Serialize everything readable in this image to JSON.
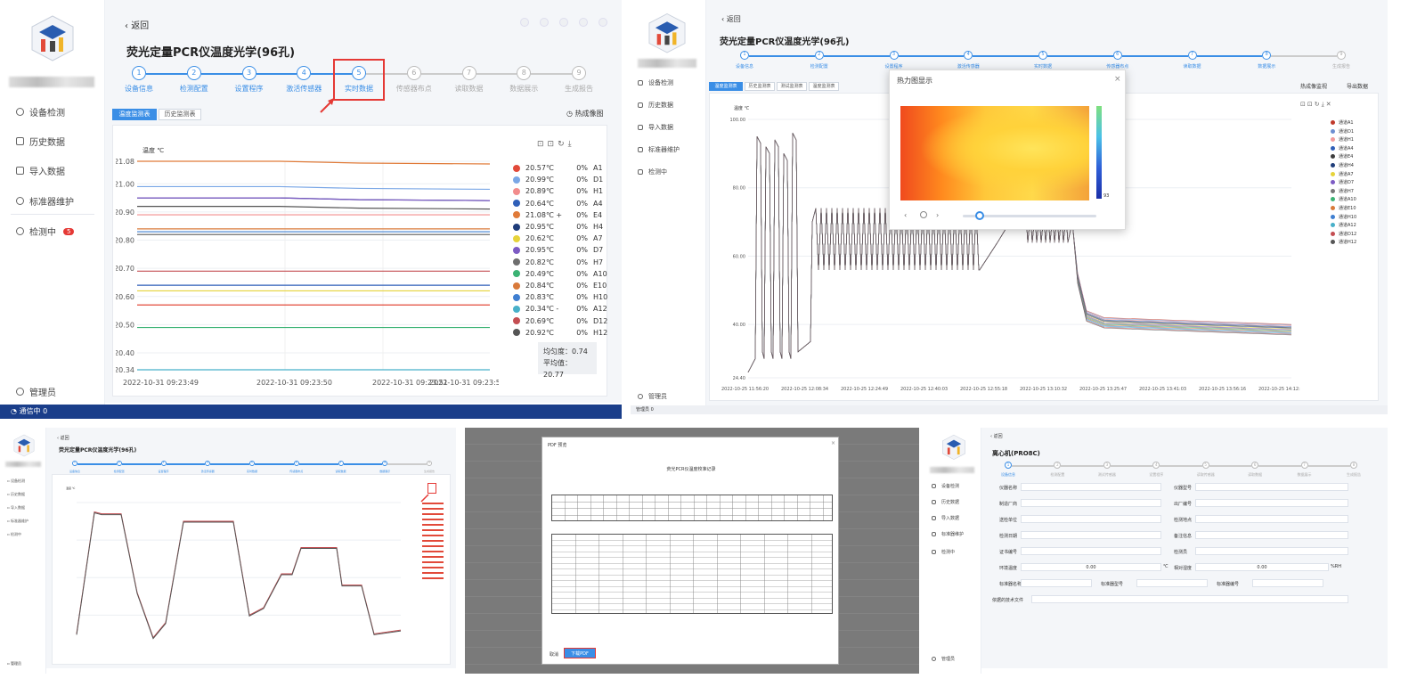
{
  "p1": {
    "back": "返回",
    "title": "荧光定量PCR仪温度光学(96孔)",
    "steps": [
      "设备信息",
      "检测配置",
      "设置程序",
      "激活传感器",
      "实时数据",
      "传感器布点",
      "读取数据",
      "数据展示",
      "生成报告"
    ],
    "nav": [
      "设备检测",
      "历史数据",
      "导入数据",
      "标准器维护",
      "检测中"
    ],
    "badge": "5",
    "admin": "管理员",
    "status": "通信中",
    "status_count": "0",
    "tabs": [
      "温度监测表",
      "历史监测表"
    ],
    "heat": "热成像图",
    "ylabel": "温度 ℃",
    "yticks": [
      "21.08",
      "21.00",
      "20.90",
      "20.80",
      "20.70",
      "20.60",
      "20.50",
      "20.40",
      "20.34"
    ],
    "xticks": [
      "2022-10-31 09:23:49",
      "2022-10-31 09:23:50",
      "2022-10-31 09:23:51",
      "2022-10-31 09:23:53"
    ],
    "legend": [
      {
        "t": "20.57℃",
        "p": "0%",
        "n": "A1",
        "c": "#e24a3a"
      },
      {
        "t": "20.99℃",
        "p": "0%",
        "n": "D1",
        "c": "#7aa7e6"
      },
      {
        "t": "20.89℃",
        "p": "0%",
        "n": "H1",
        "c": "#f28c8c"
      },
      {
        "t": "20.64℃",
        "p": "0%",
        "n": "A4",
        "c": "#2f5fb8"
      },
      {
        "t": "21.08℃",
        "m": "+",
        "p": "0%",
        "n": "E4",
        "c": "#e07b39"
      },
      {
        "t": "20.95℃",
        "p": "0%",
        "n": "H4",
        "c": "#1f3d7a"
      },
      {
        "t": "20.62℃",
        "p": "0%",
        "n": "A7",
        "c": "#e6d33a"
      },
      {
        "t": "20.95℃",
        "p": "0%",
        "n": "D7",
        "c": "#7d5bc4"
      },
      {
        "t": "20.82℃",
        "p": "0%",
        "n": "H7",
        "c": "#6e6e6e"
      },
      {
        "t": "20.49℃",
        "p": "0%",
        "n": "A10",
        "c": "#3bb273"
      },
      {
        "t": "20.84℃",
        "p": "0%",
        "n": "E10",
        "c": "#d97a3a"
      },
      {
        "t": "20.83℃",
        "p": "0%",
        "n": "H10",
        "c": "#3f7fd1"
      },
      {
        "t": "20.34℃",
        "m": "-",
        "p": "0%",
        "n": "A12",
        "c": "#48b0c9"
      },
      {
        "t": "20.69℃",
        "p": "0%",
        "n": "D12",
        "c": "#c44e52"
      },
      {
        "t": "20.92℃",
        "p": "0%",
        "n": "H12",
        "c": "#555555"
      }
    ],
    "stats": {
      "uniform_label": "均匀度：",
      "uniform": "0.74",
      "avg_label": "平均值：",
      "avg": "20.77"
    }
  },
  "p2": {
    "back": "返回",
    "title": "荧光定量PCR仪温度光学(96孔)",
    "nav": [
      "设备检测",
      "历史数据",
      "导入数据",
      "标准器维护",
      "检测中"
    ],
    "admin": "管理员",
    "status_count": "0",
    "tabs": [
      "温度监测表",
      "历史监测表",
      "测试监测表",
      "温度监测表"
    ],
    "right_buttons": [
      "热成像监视",
      "导出数据"
    ],
    "ylabel": "温度 ℃",
    "yticks": [
      "100.00",
      "80.00",
      "60.00",
      "40.00",
      "24.40"
    ],
    "xticks": [
      "2022-10-25 11:56:20",
      "2022-10-25 12:08:34",
      "2022-10-25 12:24:49",
      "2022-10-25 12:40:03",
      "2022-10-25 12:55:18",
      "2022-10-25 13:10:32",
      "2022-10-25 13:25:47",
      "2022-10-25 13:41:03",
      "2022-10-25 13:56:16",
      "2022-10-25 14:12:28"
    ],
    "legend": [
      "通道A1",
      "通道D1",
      "通道H1",
      "通道A4",
      "通道E4",
      "通道H4",
      "通道A7",
      "通道D7",
      "通道H7",
      "通道A10",
      "通道E10",
      "通道H10",
      "通道A12",
      "通道D12",
      "通道H12"
    ],
    "popup": {
      "title": "热力图显示",
      "close": "×",
      "scale_max": "",
      "scale_min": "93"
    }
  },
  "p3": {
    "back": "返回",
    "title": "荧光定量PCR仪温度光学(96孔)",
    "ylabel": "温度 ℃"
  },
  "p4": {
    "title": "PDF 预览",
    "doc_title": "荧光PCR仪温度校准记录",
    "confirm": "下载PDF",
    "cancel": "取消"
  },
  "p5": {
    "back": "返回",
    "title": "离心机(PRO8C)",
    "steps": [
      "设备信息",
      "检测配置",
      "测试传感器",
      "设置程序",
      "读取传感器",
      "读取数据",
      "数据展示",
      "生成报告"
    ],
    "nav": [
      "设备检测",
      "历史数据",
      "导入数据",
      "标准器维护",
      "检测中"
    ],
    "admin": "管理员",
    "fields_left": [
      "仪器名称",
      "制造厂商",
      "送检单位",
      "检测日期",
      "证书编号",
      "环境温度",
      "标准器名称",
      "依据的技术文件"
    ],
    "fields_right": [
      "仪器型号",
      "出厂编号",
      "检测地点",
      "备注信息",
      "检测员",
      "相对湿度"
    ],
    "temp_value": "0.00",
    "temp_unit": "℃",
    "hum_value": "0.00",
    "hum_unit": "%RH",
    "extra_labels": [
      "标准器型号",
      "标准器编号"
    ]
  },
  "colors": {
    "accent": "#3a8ee6",
    "highlight": "#e53935",
    "status_bar": "#1a3e8a"
  }
}
